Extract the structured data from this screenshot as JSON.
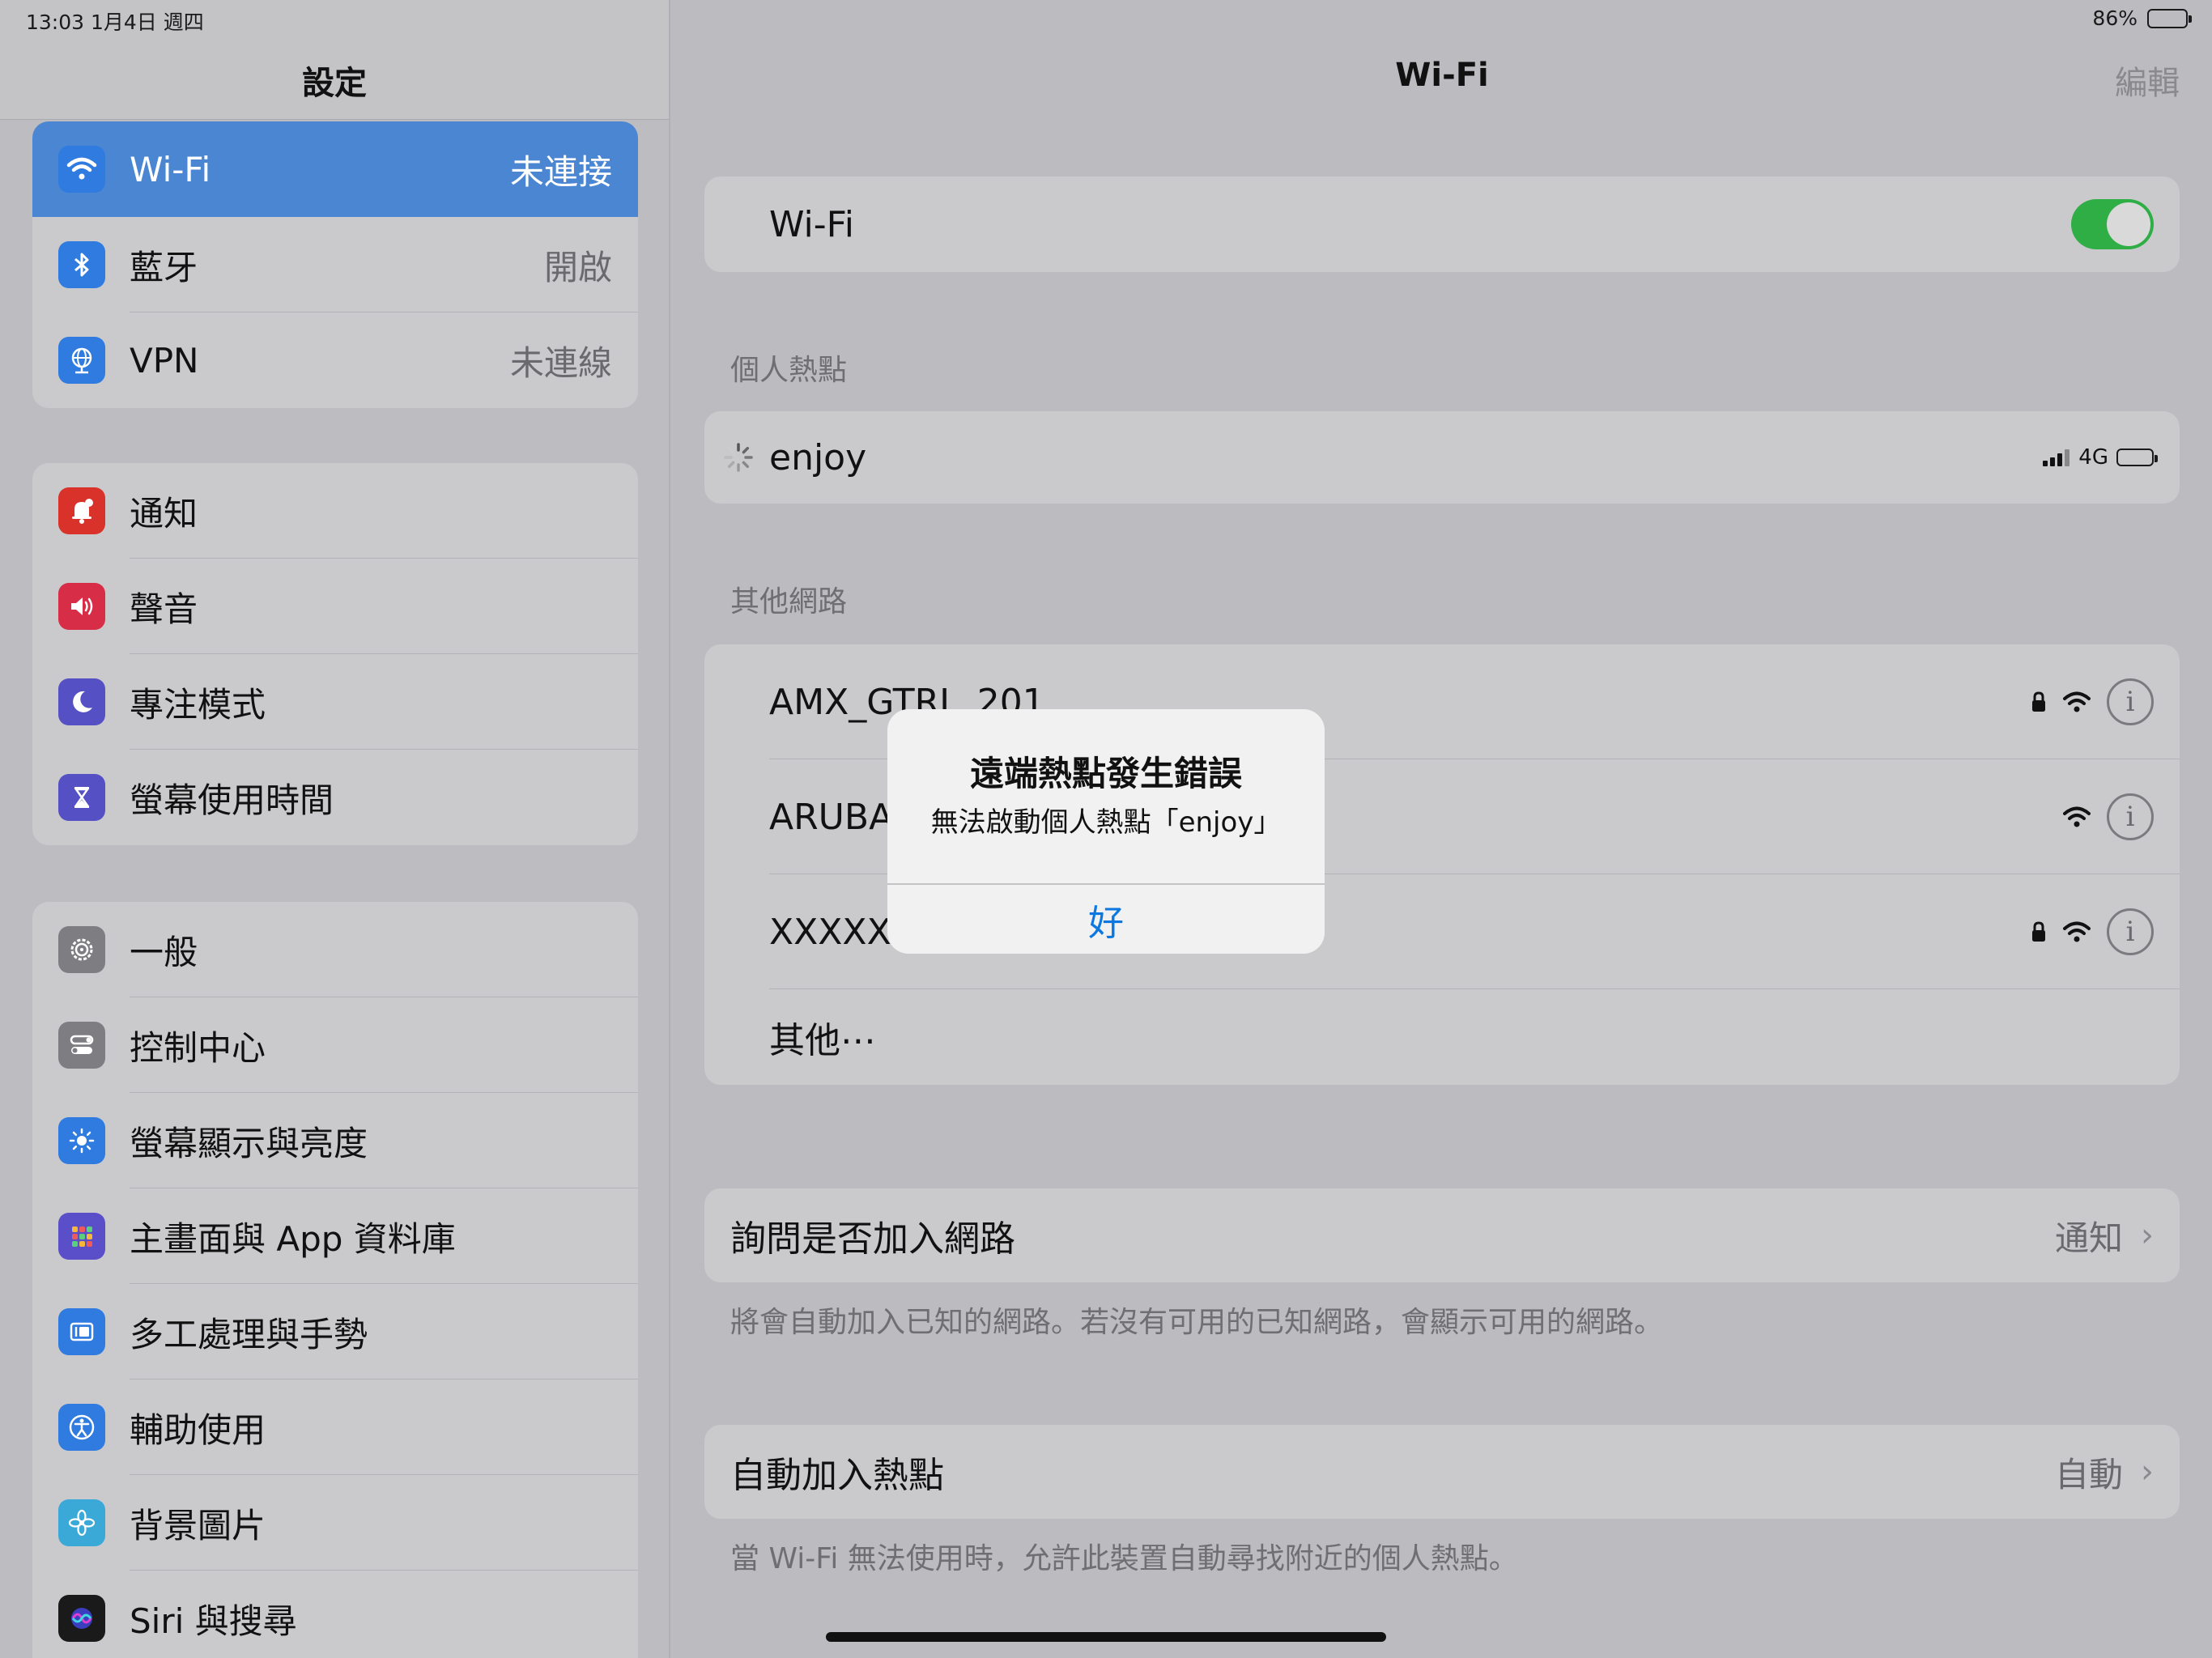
{
  "status": {
    "time_date": "13:03   1月4日 週四",
    "battery_percent": "86%",
    "battery_level": 0.86
  },
  "sidebar": {
    "title": "設定",
    "groups": [
      {
        "items": [
          {
            "label": "Wi-Fi",
            "value": "未連接",
            "icon": "wifi-icon",
            "icon_color": "#2f7be0"
          },
          {
            "label": "藍牙",
            "value": "開啟",
            "icon": "bluetooth-icon",
            "icon_color": "#2f7be0"
          },
          {
            "label": "VPN",
            "value": "未連線",
            "icon": "vpn-globe-icon",
            "icon_color": "#2f7be0"
          }
        ]
      },
      {
        "items": [
          {
            "label": "通知",
            "icon": "notification-bell-icon",
            "icon_color": "#d8322a"
          },
          {
            "label": "聲音",
            "icon": "speaker-icon",
            "icon_color": "#d82d46"
          },
          {
            "label": "專注模式",
            "icon": "moon-icon",
            "icon_color": "#5550c4"
          },
          {
            "label": "螢幕使用時間",
            "icon": "hourglass-icon",
            "icon_color": "#5550c4"
          }
        ]
      },
      {
        "items": [
          {
            "label": "一般",
            "icon": "gear-icon",
            "icon_color": "#7e7e82"
          },
          {
            "label": "控制中心",
            "icon": "toggles-icon",
            "icon_color": "#7e7e82"
          },
          {
            "label": "螢幕顯示與亮度",
            "icon": "sun-icon",
            "icon_color": "#2f7be0"
          },
          {
            "label": "主畫面與 App 資料庫",
            "icon": "app-grid-icon",
            "icon_color": "#5a4fc8"
          },
          {
            "label": "多工處理與手勢",
            "icon": "multitasking-icon",
            "icon_color": "#2f7be0"
          },
          {
            "label": "輔助使用",
            "icon": "accessibility-icon",
            "icon_color": "#2f7be0"
          },
          {
            "label": "背景圖片",
            "icon": "flower-icon",
            "icon_color": "#3aa9d8"
          },
          {
            "label": "Siri 與搜尋",
            "icon": "siri-icon",
            "icon_color": "#1a1a1a"
          }
        ]
      }
    ]
  },
  "detail": {
    "title": "Wi-Fi",
    "edit_label": "編輯",
    "wifi_label": "Wi-Fi",
    "hotspot_header": "個人熱點",
    "hotspot_name": "enjoy",
    "hotspot_network": "4G",
    "other_header": "其他網路",
    "networks": [
      {
        "name": "AMX_GTRL_201"
      },
      {
        "name": "ARUBA"
      },
      {
        "name": "XXXXX"
      }
    ],
    "other_label": "其他⋯",
    "ask_join_label": "詢問是否加入網路",
    "ask_join_value": "通知",
    "ask_join_note": "將會自動加入已知的網路。若沒有可用的已知網路，會顯示可用的網路。",
    "auto_hotspot_label": "自動加入熱點",
    "auto_hotspot_value": "自動",
    "auto_hotspot_note": "當 Wi-Fi 無法使用時，允許此裝置自動尋找附近的個人熱點。"
  },
  "alert": {
    "title": "遠端熱點發生錯誤",
    "message": "無法啟動個人熱點「enjoy」",
    "button": "好"
  }
}
